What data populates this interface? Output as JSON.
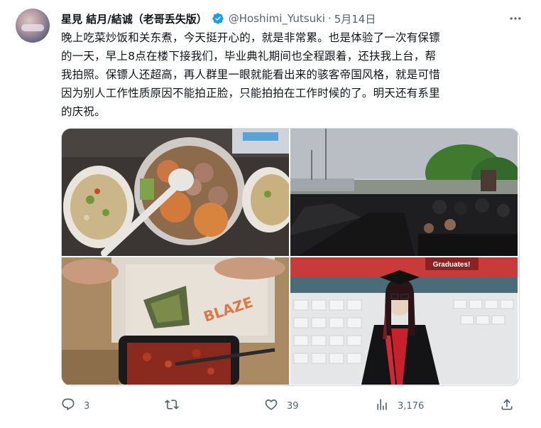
{
  "tweet": {
    "display_name": "星見 結月/結诚（老哥丢失版）",
    "handle": "@Hoshimi_Yutsuki",
    "separator": "·",
    "date": "5月14日",
    "text_lines": [
      "晚上吃菜炒饭和关东煮，今天挺开心的，就是非常累。也是体验了一次有保镖",
      "的一天，早上8点在楼下接我们，毕业典礼期间也全程跟着，还扶我上台，帮",
      "我拍照。保镖人还超高，再人群里一眼就能看出来的骇客帝国风格，就是可惜",
      "因为别人工作性质原因不能拍正脸，只能拍拍在工作时候的了。明天还有系里",
      "的庆祝。"
    ],
    "photo_signs": {
      "graduates_banner": "Graduates!",
      "pizza_box_print": "BLAZE"
    }
  },
  "stats": {
    "replies": "3",
    "retweets": "",
    "likes": "39",
    "views": "3,176"
  },
  "colors": {
    "verified_blue": "#1d9bf0",
    "text_primary": "#0f1419",
    "text_secondary": "#536471",
    "border": "#cfd9de"
  },
  "icons": [
    "verified-badge-icon",
    "more-options-icon",
    "reply-icon",
    "retweet-icon",
    "like-icon",
    "views-icon",
    "share-icon"
  ]
}
